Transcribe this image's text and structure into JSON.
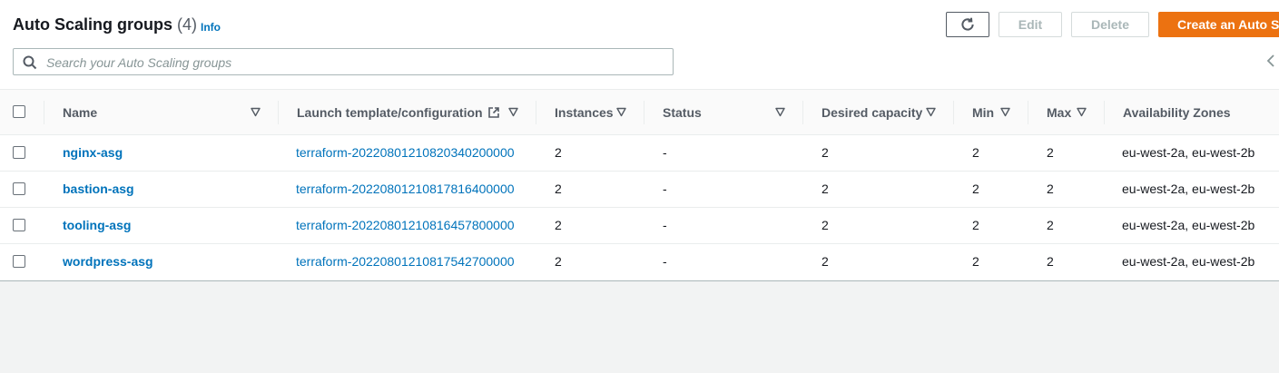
{
  "header": {
    "title": "Auto Scaling groups",
    "count": "(4)",
    "info": "Info",
    "buttons": {
      "refresh_icon": "refresh-icon",
      "edit": "Edit",
      "delete": "Delete",
      "create": "Create an Auto Scaling group"
    }
  },
  "search": {
    "placeholder": "Search your Auto Scaling groups",
    "value": ""
  },
  "table": {
    "columns": [
      "Name",
      "Launch template/configuration",
      "Instances",
      "Status",
      "Desired capacity",
      "Min",
      "Max",
      "Availability Zones"
    ],
    "rows": [
      {
        "name": "nginx-asg",
        "launch": "terraform-20220801210820340200000",
        "instances": "2",
        "status": "-",
        "desired": "2",
        "min": "2",
        "max": "2",
        "azs": "eu-west-2a, eu-west-2b"
      },
      {
        "name": "bastion-asg",
        "launch": "terraform-20220801210817816400000",
        "instances": "2",
        "status": "-",
        "desired": "2",
        "min": "2",
        "max": "2",
        "azs": "eu-west-2a, eu-west-2b"
      },
      {
        "name": "tooling-asg",
        "launch": "terraform-20220801210816457800000",
        "instances": "2",
        "status": "-",
        "desired": "2",
        "min": "2",
        "max": "2",
        "azs": "eu-west-2a, eu-west-2b"
      },
      {
        "name": "wordpress-asg",
        "launch": "terraform-20220801210817542700000",
        "instances": "2",
        "status": "-",
        "desired": "2",
        "min": "2",
        "max": "2",
        "azs": "eu-west-2a, eu-west-2b"
      }
    ]
  },
  "colors": {
    "accent": "#ec7211",
    "link": "#0073bb",
    "text": "#16191f"
  }
}
